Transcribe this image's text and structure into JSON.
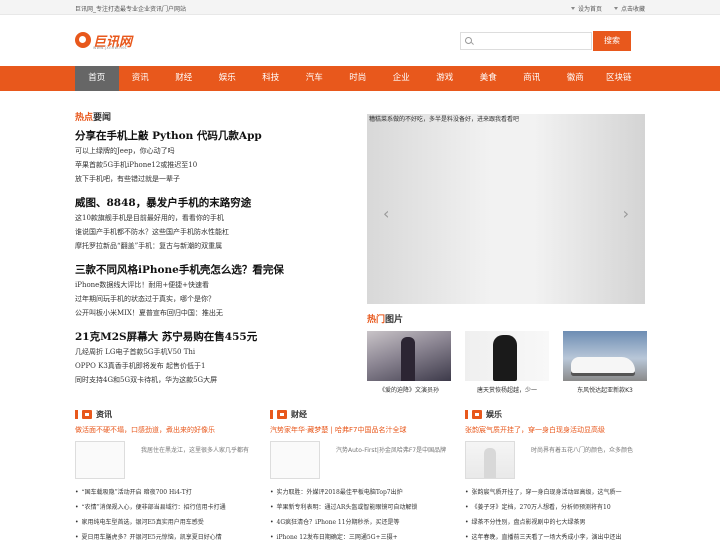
{
  "topbar": {
    "slogan": "巨讯网_专注打造最专业企业资讯门户网站",
    "set_home": "设为首页",
    "bookmark": "点击收藏"
  },
  "logo": {
    "name": "巨讯网",
    "url": "www.jxnew.net"
  },
  "search": {
    "placeholder": "",
    "button": "搜索"
  },
  "nav": [
    "首页",
    "资讯",
    "财经",
    "娱乐",
    "科技",
    "汽车",
    "时尚",
    "企业",
    "游戏",
    "美食",
    "商讯",
    "徽商",
    "区块链"
  ],
  "hot_news": {
    "title_hl": "热点",
    "title_rest": "要闻",
    "blocks": [
      {
        "headline": "分享在手机上敲 Python 代码几款App",
        "items": [
          "可以上绿牌的Jeep，你心动了吗",
          "苹果首款5G手机iPhone12或推迟至10",
          "放下手机吧，有些错过就是一辈子"
        ]
      },
      {
        "headline": "威图、8848，暴发户手机的末路穷途",
        "items": [
          "这10款旗舰手机是目前最好用的，看看你的手机",
          "谁说国产手机都不防水？这些国产手机防水性能杠",
          "摩托罗拉新品“翻盖”手机：复古与新潮的双重属"
        ]
      },
      {
        "headline": "三款不同风格iPhone手机壳怎么选？看完保",
        "items": [
          "iPhone数据线大评比！耐用+便捷+快速看",
          "过年期间玩手机的状态过于真实，哪个是你？",
          "公开叫板小米MIX！夏普宣布回归中国：推出无"
        ]
      },
      {
        "headline": "21克M2S屏幕大 苏宁易购在售455元",
        "items": [
          "几经周折 LG电子首款5G手机V50 Thi",
          "OPPO K3真香手机即将发布 起售价低于1",
          "同时支持4G和5G双卡待机，华为这款5G大屏"
        ]
      }
    ]
  },
  "carousel": {
    "caption": "糟糕菜系做的不好吃，多半是料没备好，进来跟我看看吧",
    "prev": "‹",
    "next": "›"
  },
  "hot_pics": {
    "title_hl": "热门",
    "title_rest": "图片",
    "items": [
      {
        "caption": "《爱的迫降》文演员孙"
      },
      {
        "caption": "唐天赏恢杨超越，少一"
      },
      {
        "caption": "东风悦达起亚新款K3"
      }
    ]
  },
  "categories": [
    {
      "title": "资讯",
      "lead": "做活面不硬不塌，口感劲道，煮出来的好像乐",
      "desc": "我居住在黑龙江，这里很多人家几乎都有",
      "items": [
        "“国车载吸隐”活动开启 暗夜700 Hi4-T打",
        "“农情”消保规入心，便非部当县域行：招行信用卡打通",
        "家用纯电车型首选，银河E5真实用户用车感受",
        "夏日用车膳虎多？开银河E5元惊恼，凯享夏日好心情"
      ]
    },
    {
      "title": "财经",
      "lead": "汽势家年华·藏梦楚 | 哈弗F7中国品名汁全球",
      "desc": "汽势Auto-First|孙金凤哈弗F7是中国品牌",
      "items": [
        "实力取胜：外媒评2018最佳平板电脑Top7出炉",
        "苹果新专利表明：通过AR头盔或智能眼镜可自动解锁",
        "4G疯狂清仓？iPhone 11分期秒杀，买还是等",
        "iPhone 12发布日期确定：三网通5G+三摄+"
      ]
    },
    {
      "title": "娱乐",
      "lead": "张韵宸气质开挂了，穿一身白现身活动显高级",
      "desc": "时尚界有着五花八门的颜色，众多颜色",
      "items": [
        "张韵宸气质开挂了，穿一身白现身活动显高级，这气质一",
        "《姜子牙》定档，270万人想看，分析师预测将有10",
        "绿茶不分性别，盘点影视剧中的七大绿茶男",
        "这年春晚，直播前三天看了一场大秀成小李，演出中还出"
      ]
    }
  ]
}
